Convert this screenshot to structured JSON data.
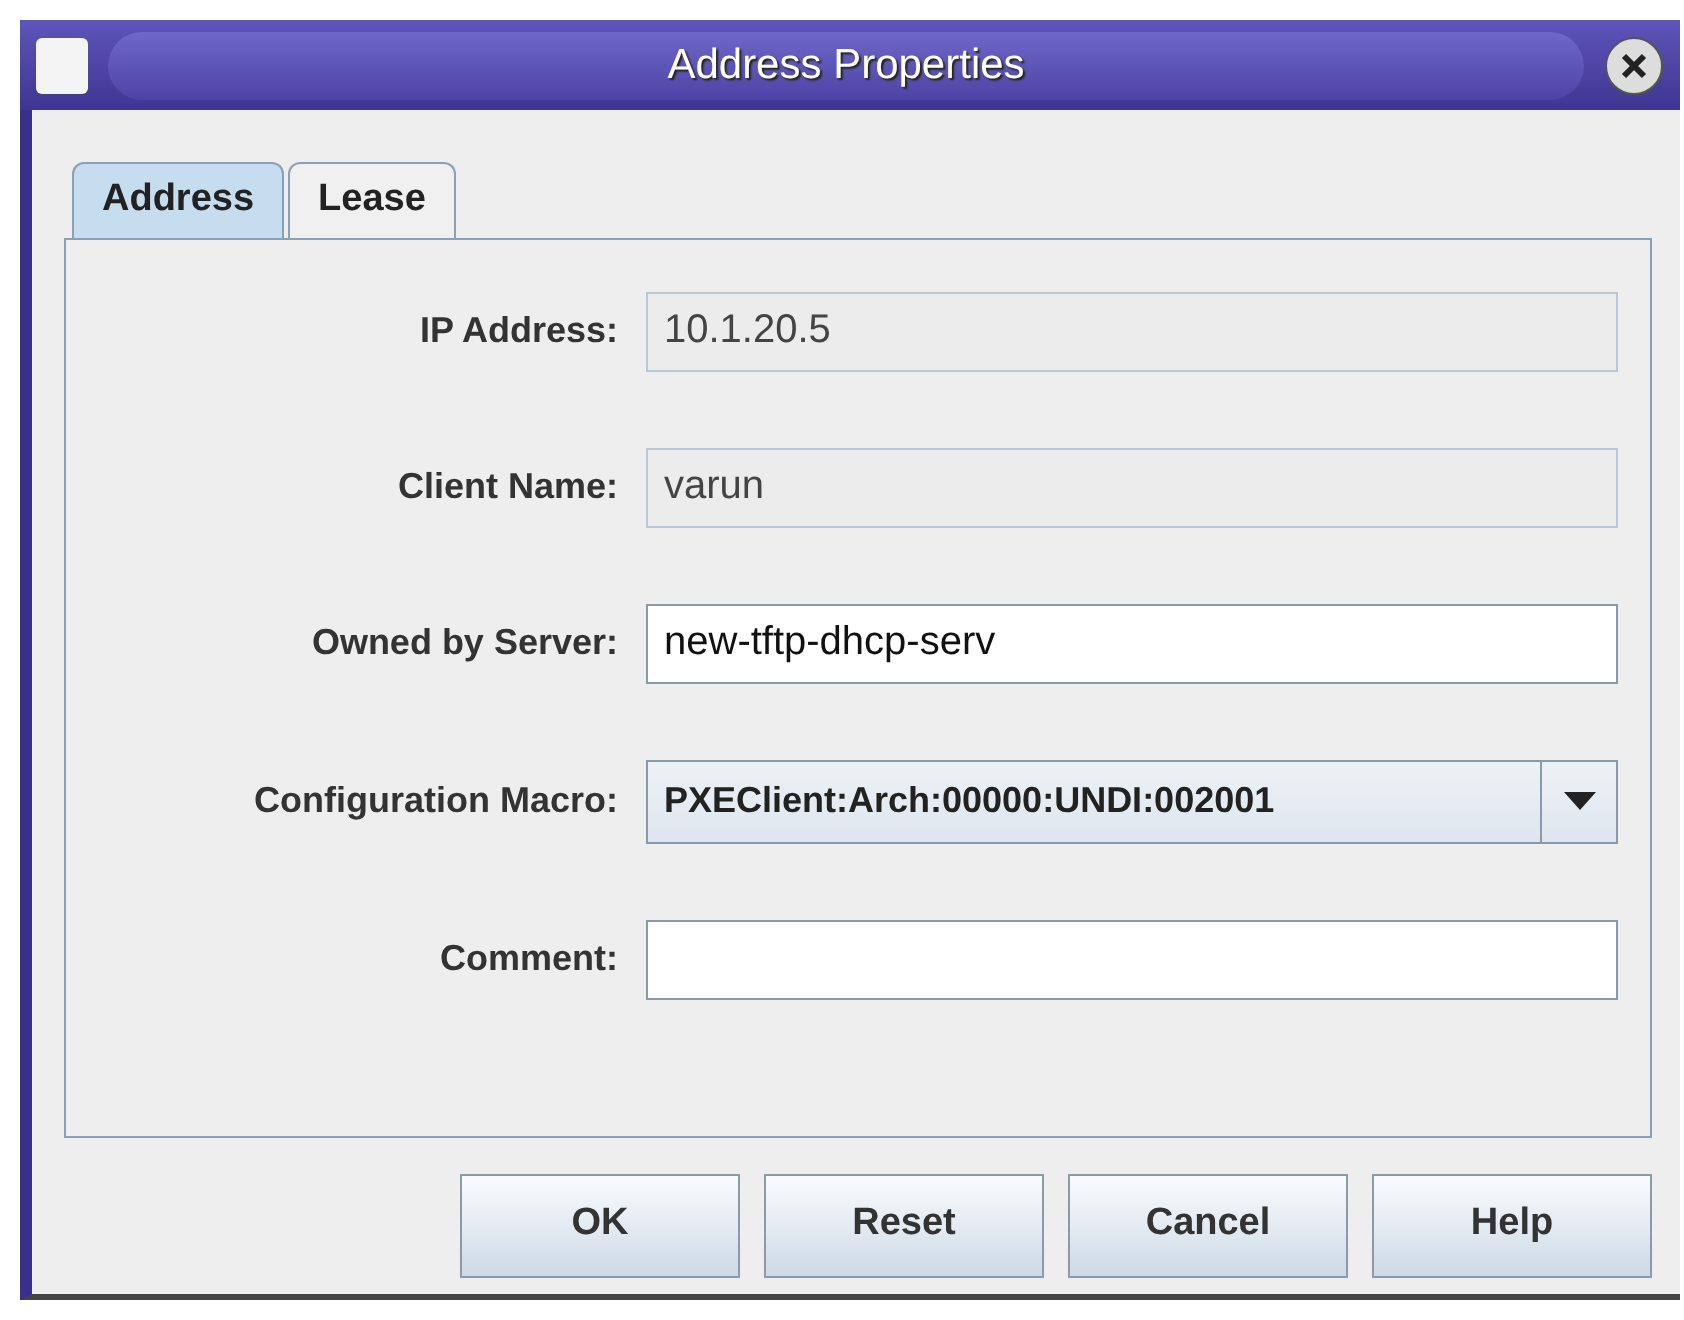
{
  "window": {
    "title": "Address Properties"
  },
  "tabs": [
    {
      "label": "Address",
      "selected": true
    },
    {
      "label": "Lease",
      "selected": false
    }
  ],
  "fields": [
    {
      "kind": "text",
      "label": "IP Address:",
      "value": "10.1.20.5",
      "disabled": true
    },
    {
      "kind": "text",
      "label": "Client Name:",
      "value": "varun",
      "disabled": true
    },
    {
      "kind": "text",
      "label": "Owned by Server:",
      "value": "new-tftp-dhcp-serv",
      "disabled": false
    },
    {
      "kind": "combo",
      "label": "Configuration Macro:",
      "value": "PXEClient:Arch:00000:UNDI:002001"
    },
    {
      "kind": "text",
      "label": "Comment:",
      "disabled": false
    }
  ],
  "buttons": [
    {
      "label": "OK"
    },
    {
      "label": "Reset"
    },
    {
      "label": "Cancel"
    },
    {
      "label": "Help"
    }
  ]
}
